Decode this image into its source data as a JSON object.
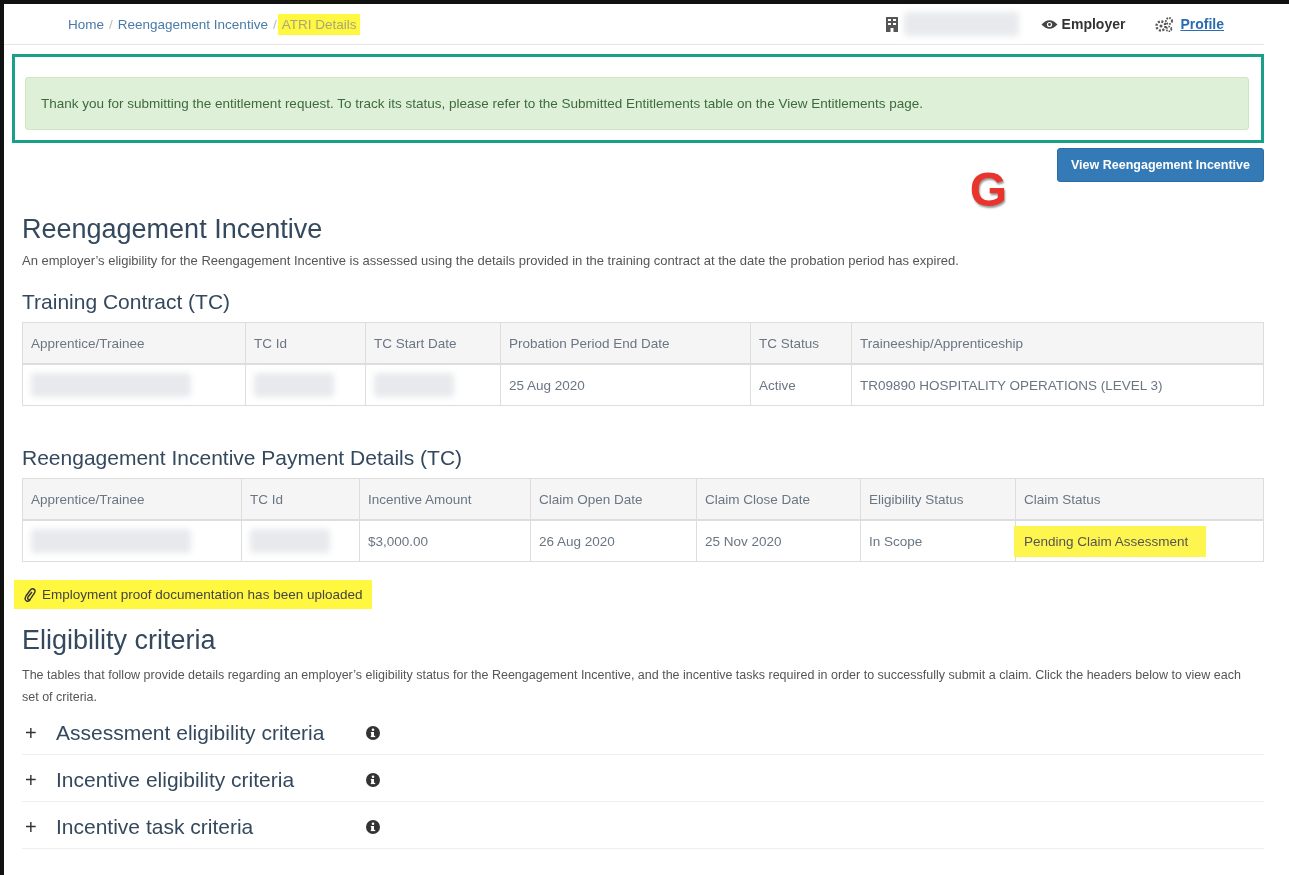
{
  "breadcrumb": [
    {
      "label": "Home",
      "highlighted": false
    },
    {
      "separator": "/",
      "label": "Reengagement Incentive",
      "highlighted": false
    },
    {
      "separator": "/",
      "label": "ATRI Details",
      "highlighted": true
    }
  ],
  "topbar": {
    "organisation": {
      "kind": "redacted"
    },
    "role": "Employer",
    "profile_link": "Profile"
  },
  "alert": {
    "text": "Thank you for submitting the entitlement request. To track its status, please refer to the Submitted Entitlements table on the View Entitlements page.",
    "outlined": true
  },
  "view_button": "View Reengagement Incentive",
  "annotation_mark": "G",
  "title": "Reengagement Incentive",
  "intro": "An employer’s eligibility for the Reengagement Incentive is assessed using the details provided in the training contract at the date the probation period has expired.",
  "tables": [
    {
      "heading": "Training Contract (TC)",
      "columns": [
        "Apprentice/Trainee",
        "TC Id",
        "TC Start Date",
        "Probation Period End Date",
        "TC Status",
        "Traineeship/Apprenticeship"
      ],
      "rows": [
        [
          {
            "kind": "redacted"
          },
          {
            "kind": "redacted"
          },
          {
            "kind": "redacted"
          },
          {
            "kind": "text",
            "text": "25 Aug 2020",
            "highlighted": false
          },
          {
            "kind": "text",
            "text": "Active",
            "highlighted": false
          },
          {
            "kind": "text",
            "text": "TR09890 HOSPITALITY OPERATIONS (LEVEL 3)",
            "highlighted": false
          }
        ]
      ]
    },
    {
      "heading": "Reengagement Incentive Payment Details (TC)",
      "columns": [
        "Apprentice/Trainee",
        "TC Id",
        "Incentive Amount",
        "Claim Open Date",
        "Claim Close Date",
        "Eligibility Status",
        "Claim Status"
      ],
      "rows": [
        [
          {
            "kind": "redacted"
          },
          {
            "kind": "redacted"
          },
          {
            "kind": "text",
            "text": "$3,000.00",
            "highlighted": false
          },
          {
            "kind": "text",
            "text": "26 Aug 2020",
            "highlighted": false
          },
          {
            "kind": "text",
            "text": "25 Nov 2020",
            "highlighted": false
          },
          {
            "kind": "text",
            "text": "In Scope",
            "highlighted": false
          },
          {
            "kind": "text",
            "text": "Pending Claim Assessment",
            "highlighted": true
          }
        ]
      ]
    }
  ],
  "upload_note": {
    "text": "Employment proof documentation has been uploaded",
    "highlighted": true
  },
  "criteria": {
    "heading": "Eligibility criteria",
    "description": "The tables that follow provide details regarding an employer’s eligibility status for the Reengagement Incentive, and the incentive tasks required in order to successfully submit a claim. Click the headers below to view each set of criteria.",
    "sections": [
      {
        "toggle": "+",
        "label": "Assessment eligibility criteria"
      },
      {
        "toggle": "+",
        "label": "Incentive eligibility criteria"
      },
      {
        "toggle": "+",
        "label": "Incentive task criteria"
      }
    ]
  }
}
